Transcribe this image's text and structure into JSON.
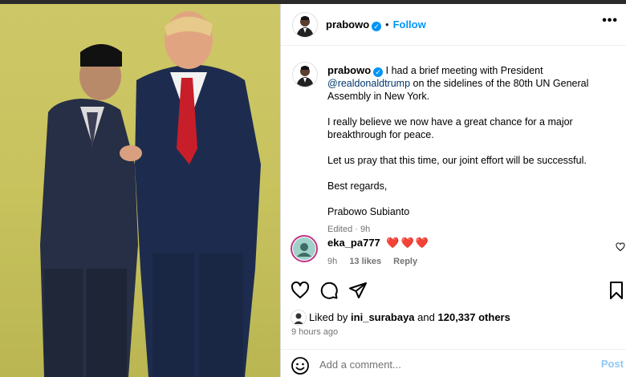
{
  "post": {
    "author": {
      "handle": "prabowo",
      "verified": true
    },
    "follow_label": "Follow",
    "dot": "•",
    "more_label": "•••",
    "caption": {
      "line1": "I had a brief meeting with President",
      "mention": "@realdonaldtrump",
      "line1_rest": "on the sidelines of the 80th UN General Assembly in New York.",
      "para2": "I really believe we now have a great chance for a major breakthrough for peace.",
      "para3": "Let us pray that this time, our joint effort will be successful.",
      "para4": "Best regards,",
      "signature": "Prabowo Subianto"
    },
    "edited": "Edited · 9h"
  },
  "comment": {
    "username": "eka_pa777",
    "hearts": "❤️❤️❤️",
    "age": "9h",
    "likes": "13 likes",
    "reply": "Reply"
  },
  "likes": {
    "prefix": "Liked by",
    "user": "ini_surabaya",
    "joiner": "and",
    "count": "120,337 others"
  },
  "time_ago": "9 hours ago",
  "composer": {
    "placeholder": "Add a comment...",
    "post_label": "Post"
  },
  "icons": [
    "heart-icon",
    "comment-icon",
    "share-icon",
    "bookmark-icon",
    "emoji-icon",
    "verified-icon",
    "more-icon"
  ],
  "colors": {
    "accent": "#0095f6",
    "mention": "#00376b",
    "heart": "#ed2a55",
    "muted": "#737373"
  }
}
